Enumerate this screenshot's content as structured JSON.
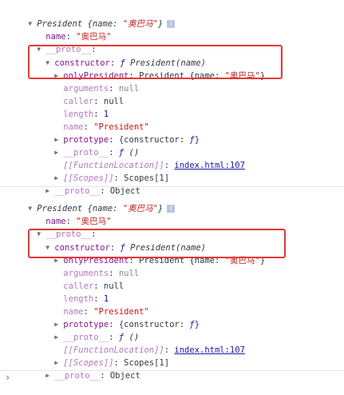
{
  "blocks": [
    {
      "header": {
        "cls": "President",
        "name_key": "name",
        "name_val": "\"奥巴马\"",
        "info": "i"
      },
      "name_line": {
        "key": "name",
        "val": "\"奥巴马\""
      },
      "proto_line": {
        "key": "__proto__"
      },
      "constructor_line": {
        "key": "constructor",
        "f": "ƒ",
        "sig": "President(name)"
      },
      "only_line": {
        "key": "onlyPresident",
        "cls": "President",
        "name_key": "name",
        "name_val": "\"奥巴马\""
      },
      "arguments_line": {
        "key": "arguments",
        "val": "null"
      },
      "caller_line": {
        "key": "caller",
        "val": "null"
      },
      "length_line": {
        "key": "length",
        "val": "1"
      },
      "fname_line": {
        "key": "name",
        "val": "\"President\""
      },
      "prototype_line": {
        "key": "prototype",
        "inner_key": "constructor",
        "f": "ƒ"
      },
      "fproto_line": {
        "key": "__proto__",
        "f": "ƒ",
        "sig": "()"
      },
      "location_line": {
        "key": "[[FunctionLocation]]",
        "link": "index.html:107"
      },
      "scopes_line": {
        "key": "[[Scopes]]",
        "val": "Scopes[1]"
      },
      "objproto_line": {
        "key": "__proto__",
        "val": "Object"
      }
    },
    {
      "header": {
        "cls": "President",
        "name_key": "name",
        "name_val": "\"奥巴马\"",
        "info": "i"
      },
      "name_line": {
        "key": "name",
        "val": "\"奥巴马\""
      },
      "proto_line": {
        "key": "__proto__"
      },
      "constructor_line": {
        "key": "constructor",
        "f": "ƒ",
        "sig": "President(name)"
      },
      "only_line": {
        "key": "onlyPresident",
        "cls": "President",
        "name_key": "name",
        "name_val": "\"奥巴马\""
      },
      "arguments_line": {
        "key": "arguments",
        "val": "null"
      },
      "caller_line": {
        "key": "caller",
        "val": "null"
      },
      "length_line": {
        "key": "length",
        "val": "1"
      },
      "fname_line": {
        "key": "name",
        "val": "\"President\""
      },
      "prototype_line": {
        "key": "prototype",
        "inner_key": "constructor",
        "f": "ƒ"
      },
      "fproto_line": {
        "key": "__proto__",
        "f": "ƒ",
        "sig": "()"
      },
      "location_line": {
        "key": "[[FunctionLocation]]",
        "link": "index.html:107"
      },
      "scopes_line": {
        "key": "[[Scopes]]",
        "val": "Scopes[1]"
      },
      "objproto_line": {
        "key": "__proto__",
        "val": "Object"
      }
    }
  ],
  "prompt": "›",
  "colors": {
    "highlight_box": "#e53935",
    "key": "#881391",
    "string": "#c41a16",
    "number": "#1c00cf"
  }
}
